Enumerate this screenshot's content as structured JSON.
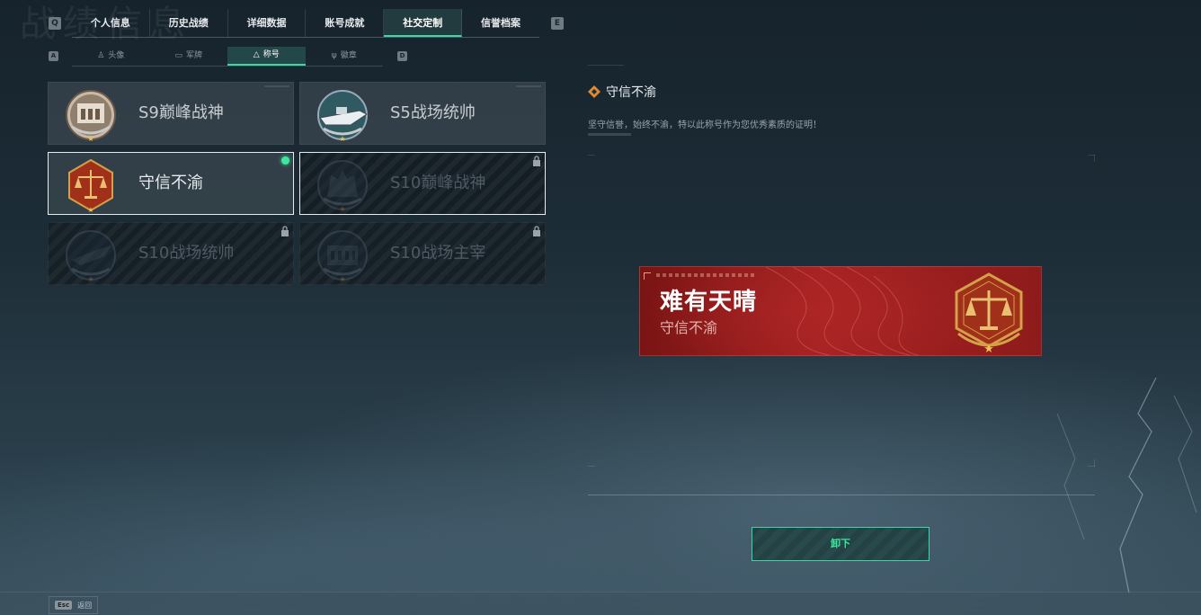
{
  "header": {
    "bg_title": "战绩信息",
    "left_key": "Q",
    "right_key": "E",
    "sub_left_key": "A",
    "sub_right_key": "D"
  },
  "main_tabs": [
    {
      "label": "个人信息"
    },
    {
      "label": "历史战绩"
    },
    {
      "label": "详细数据"
    },
    {
      "label": "账号成就"
    },
    {
      "label": "社交定制",
      "active": true
    },
    {
      "label": "信誉档案"
    }
  ],
  "sub_tabs": [
    {
      "label": "头像",
      "icon": "person-icon"
    },
    {
      "label": "军牌",
      "icon": "dogtag-icon"
    },
    {
      "label": "称号",
      "icon": "triangle-icon",
      "active": true
    },
    {
      "label": "徽章",
      "icon": "wing-badge-icon"
    }
  ],
  "titles": [
    {
      "label": "S9巅峰战神",
      "emblem": "fortress-emblem",
      "locked": false
    },
    {
      "label": "S5战场统帅",
      "emblem": "warship-emblem",
      "locked": false
    },
    {
      "label": "守信不渝",
      "emblem": "scales-emblem",
      "locked": false,
      "equipped": true,
      "selected": true
    },
    {
      "label": "S10巅峰战神",
      "emblem": "fortress-emblem",
      "locked": true,
      "selected": true
    },
    {
      "label": "S10战场统帅",
      "emblem": "jet-emblem",
      "locked": true
    },
    {
      "label": "S10战场主宰",
      "emblem": "colosseum-emblem",
      "locked": true
    }
  ],
  "detail": {
    "name": "守信不渝",
    "description": "坚守信誉，始终不渝，特以此称号作为您优秀素质的证明！",
    "banner_main": "难有天晴",
    "banner_sub": "守信不渝",
    "button_label": "卸下"
  },
  "footer": {
    "esc_key": "Esc",
    "esc_label": "返回"
  },
  "colors": {
    "accent": "#3dd6a5",
    "equipped_dot": "#3be89c",
    "banner_red": "#a52222",
    "gold": "#d4a048"
  }
}
